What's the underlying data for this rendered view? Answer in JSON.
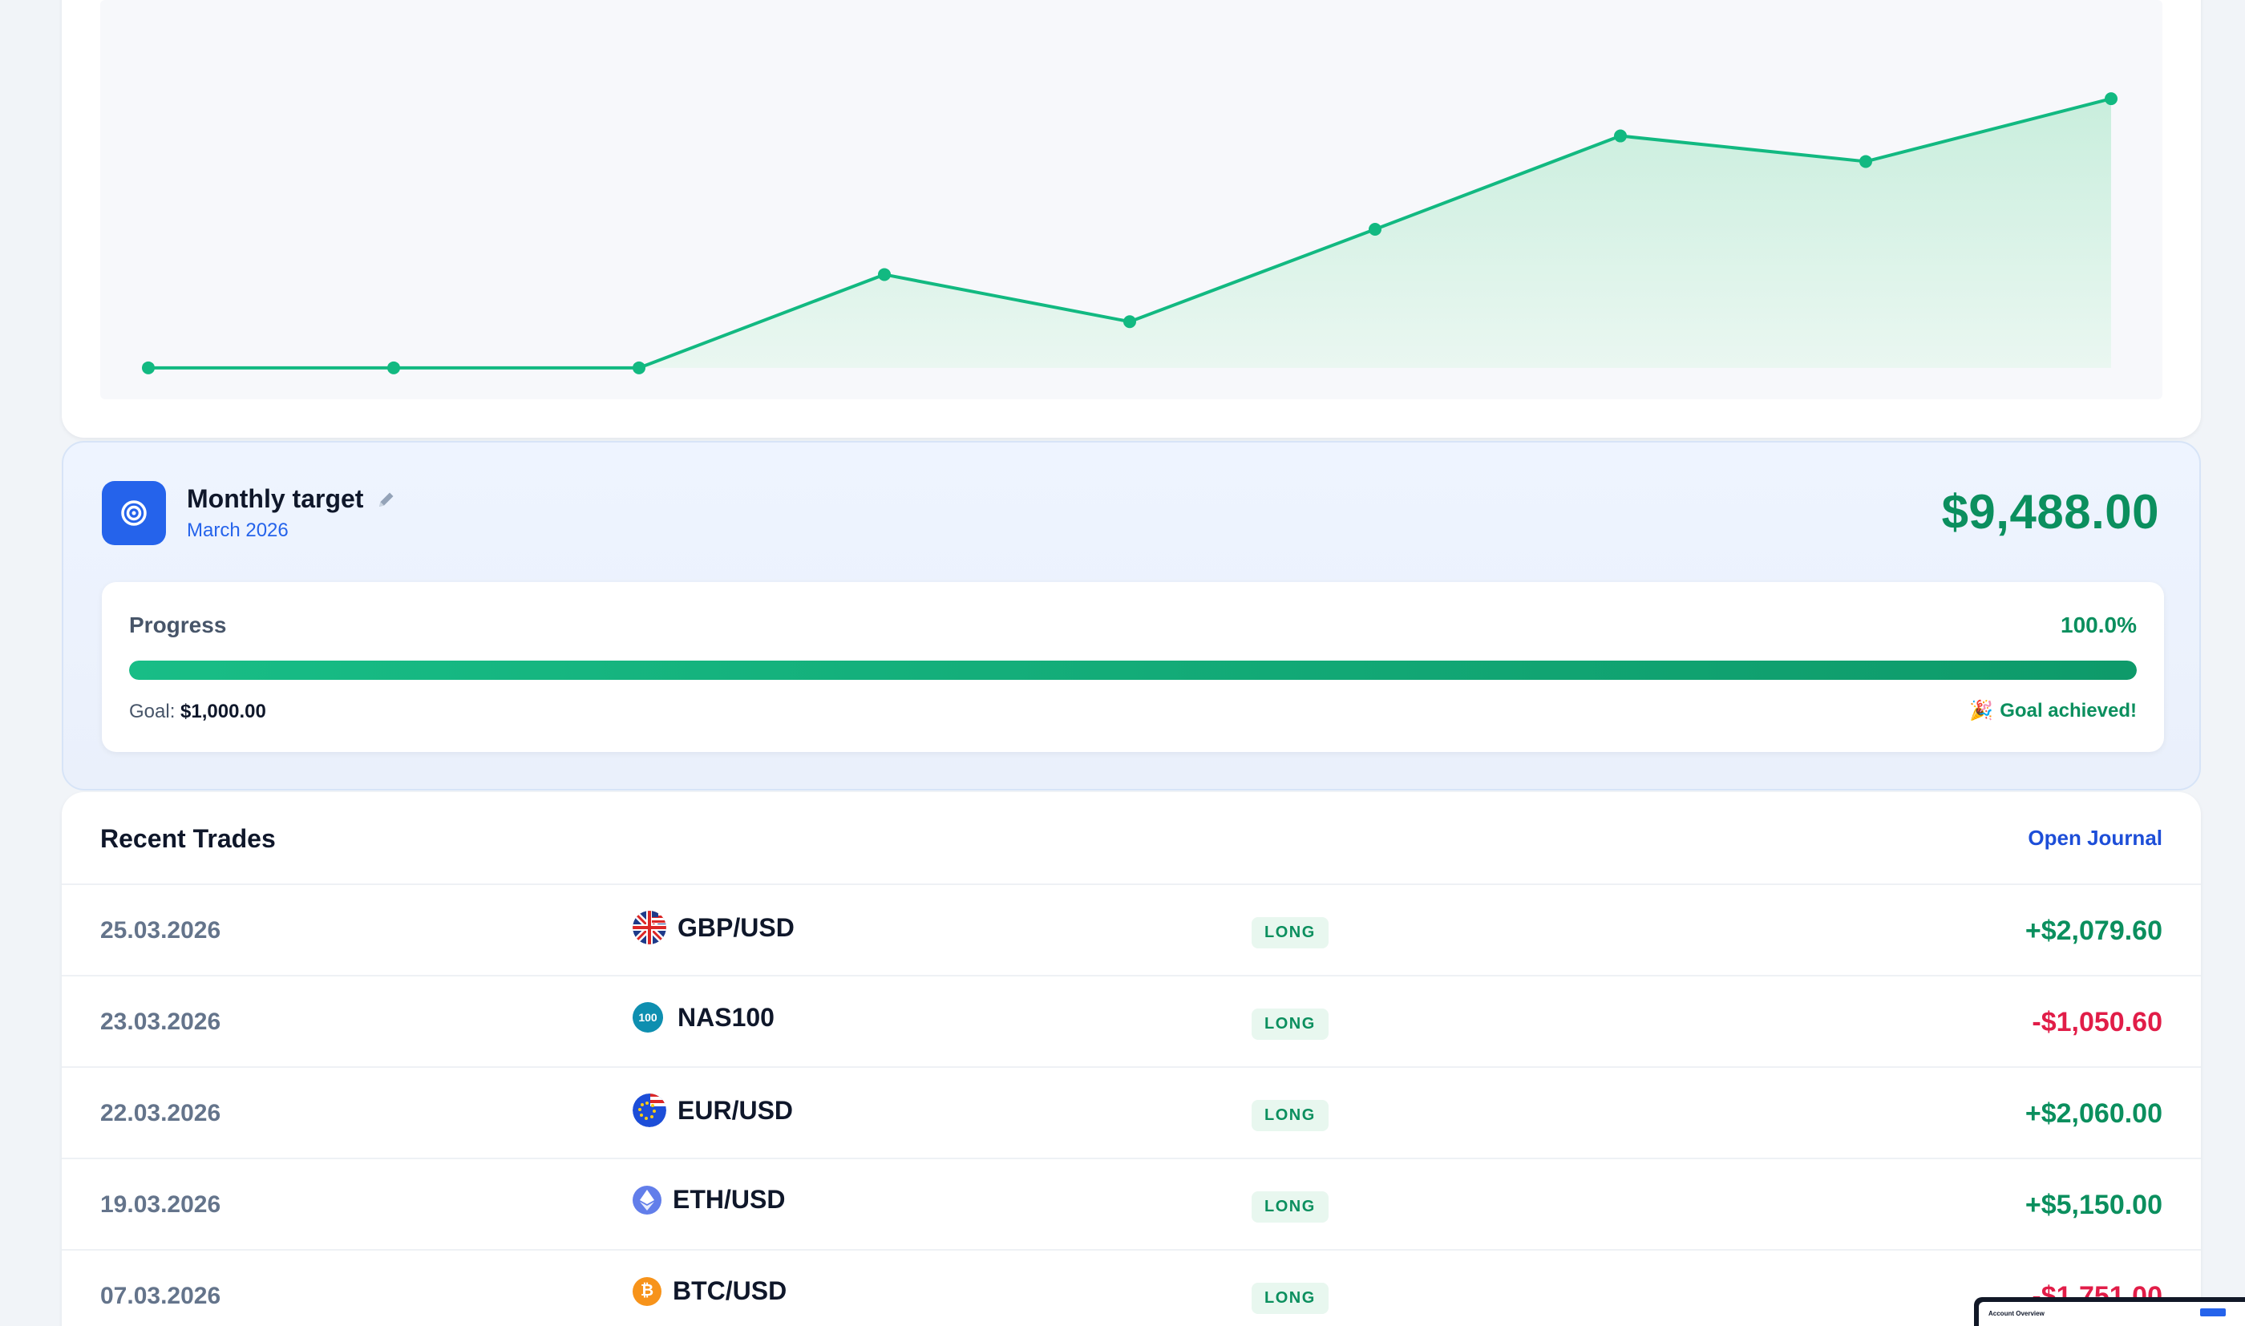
{
  "colors": {
    "positive": "#0b8f5e",
    "negative": "#e11d48",
    "accent": "#2563eb",
    "line": "#12b981"
  },
  "chart_data": {
    "type": "area",
    "x": [
      "p1",
      "p2",
      "p3",
      "p4",
      "p5",
      "p6",
      "p7",
      "p8",
      "p9"
    ],
    "values": [
      0,
      0,
      0,
      2079.6,
      1029.0,
      3089.0,
      5170.0,
      4600.0,
      6000.0
    ],
    "ylim": [
      -700,
      8200
    ],
    "title": "",
    "xlabel": "",
    "ylabel": ""
  },
  "target": {
    "title": "Monthly target",
    "month": "March 2026",
    "amount": "$9,488.00",
    "progress_label": "Progress",
    "progress_pct": "100.0%",
    "progress_value": 1.0,
    "goal_label": "Goal:",
    "goal_value": "$1,000.00",
    "achieved_text": "Goal achieved!",
    "achieved_emoji": "🎉"
  },
  "trades": {
    "title": "Recent Trades",
    "open_journal": "Open Journal",
    "rows": [
      {
        "date": "25.03.2026",
        "symbol": "GBP/USD",
        "icon": "gbp-usd-flag-icon",
        "side": "LONG",
        "pnl": "+$2,079.60",
        "positive": true
      },
      {
        "date": "23.03.2026",
        "symbol": "NAS100",
        "icon": "nas100-icon",
        "icon_text": "100",
        "side": "LONG",
        "pnl": "-$1,050.60",
        "positive": false
      },
      {
        "date": "22.03.2026",
        "symbol": "EUR/USD",
        "icon": "eur-usd-flag-icon",
        "side": "LONG",
        "pnl": "+$2,060.00",
        "positive": true
      },
      {
        "date": "19.03.2026",
        "symbol": "ETH/USD",
        "icon": "ethereum-icon",
        "side": "LONG",
        "pnl": "+$5,150.00",
        "positive": true
      },
      {
        "date": "07.03.2026",
        "symbol": "BTC/USD",
        "icon": "bitcoin-icon",
        "side": "LONG",
        "pnl": "-$1,751.00",
        "positive": false
      }
    ]
  },
  "mini_window": {
    "title": "Account Overview"
  }
}
